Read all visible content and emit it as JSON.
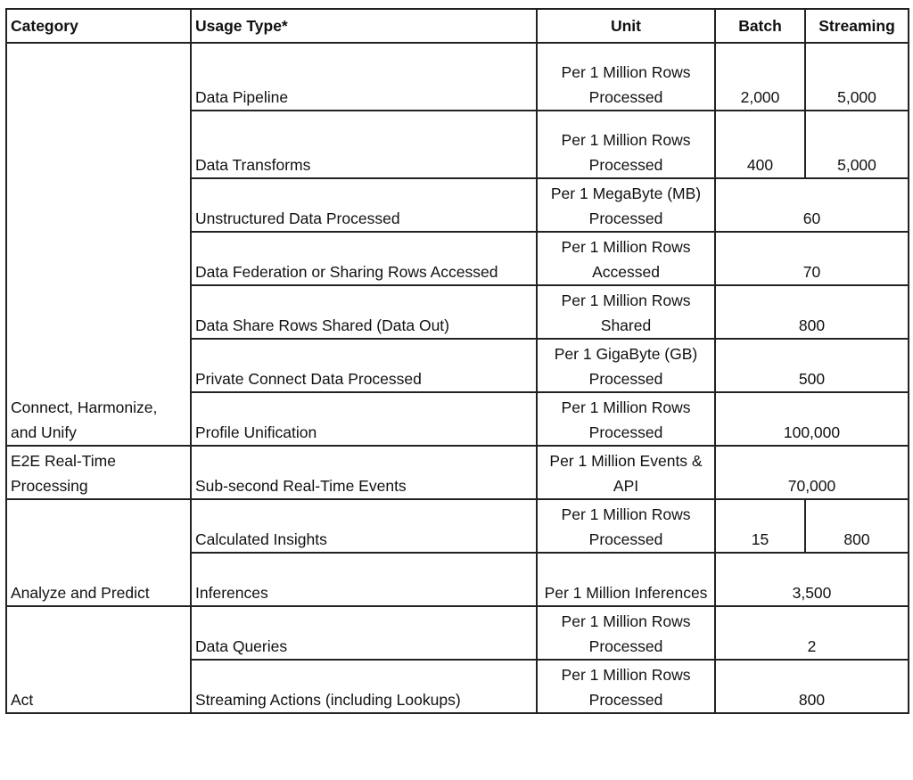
{
  "table": {
    "headers": {
      "category": "Category",
      "usage_type": "Usage Type*",
      "unit": "Unit",
      "batch": "Batch",
      "streaming": "Streaming"
    },
    "groups": [
      {
        "category": "Connect, Harmonize, and Unify",
        "rows": [
          {
            "usage_type": "Data Pipeline",
            "unit": "Per 1 Million Rows Processed",
            "batch": "2,000",
            "streaming": "5,000"
          },
          {
            "usage_type": "Data Transforms",
            "unit": "Per 1 Million Rows Processed",
            "batch": "400",
            "streaming": "5,000"
          },
          {
            "usage_type": "Unstructured Data Processed",
            "unit": "Per 1 MegaByte (MB) Processed",
            "value": "60"
          },
          {
            "usage_type": "Data Federation or Sharing Rows Accessed",
            "unit": "Per 1 Million Rows Accessed",
            "value": "70"
          },
          {
            "usage_type": "Data Share Rows Shared (Data Out)",
            "unit": "Per 1 Million Rows Shared",
            "value": "800"
          },
          {
            "usage_type": "Private Connect Data Processed",
            "unit": "Per 1 GigaByte (GB) Processed",
            "value": "500"
          },
          {
            "usage_type": "Profile Unification",
            "unit": "Per 1 Million Rows Processed",
            "value": "100,000"
          }
        ]
      },
      {
        "category": "E2E Real-Time Processing",
        "rows": [
          {
            "usage_type": "Sub-second Real-Time Events",
            "unit": "Per 1 Million Events & API",
            "value": "70,000"
          }
        ]
      },
      {
        "category": "Analyze and Predict",
        "rows": [
          {
            "usage_type": "Calculated Insights",
            "unit": "Per 1 Million Rows Processed",
            "batch": "15",
            "streaming": "800"
          },
          {
            "usage_type": "Inferences",
            "unit": "Per 1 Million Inferences",
            "value": "3,500"
          }
        ]
      },
      {
        "category": "Act",
        "rows": [
          {
            "usage_type": "Data Queries",
            "unit": "Per 1 Million Rows Processed",
            "value": "2"
          },
          {
            "usage_type": "Streaming Actions (including Lookups)",
            "unit": "Per 1 Million Rows Processed",
            "value": "800"
          }
        ]
      }
    ]
  }
}
